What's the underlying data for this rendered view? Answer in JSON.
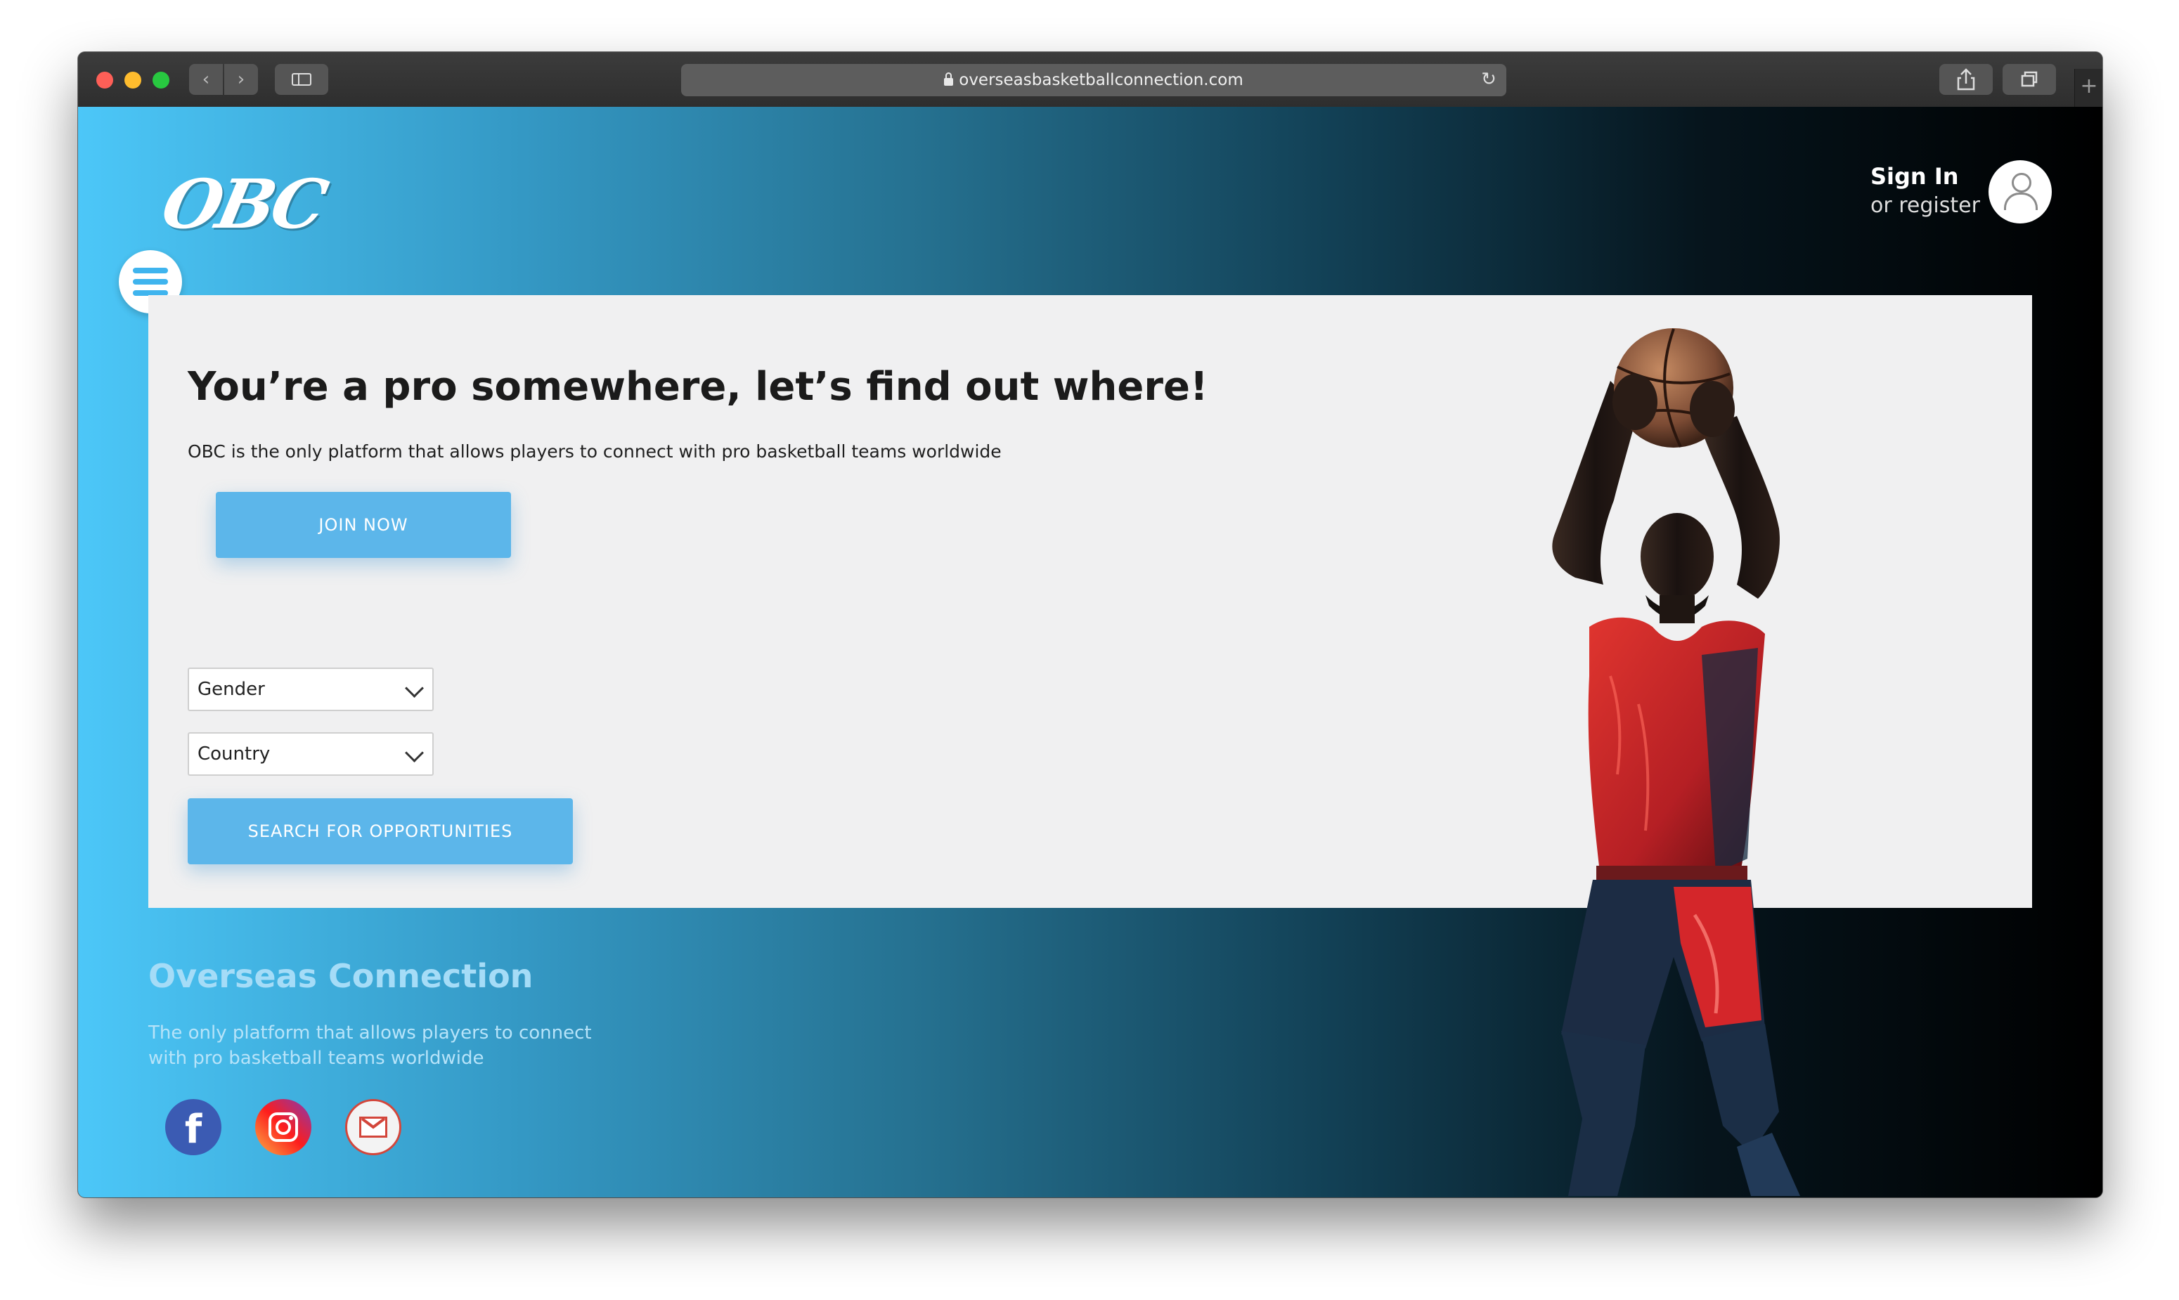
{
  "browser": {
    "url": "overseasbasketballconnection.com",
    "nav_back": "‹",
    "nav_forward": "›",
    "reload": "↻",
    "new_tab": "+"
  },
  "header": {
    "logo_text": "OBC",
    "signin_label": "Sign In",
    "register_label": "or register"
  },
  "hero": {
    "title": "You’re a pro somewhere, let’s find out where!",
    "subtitle": "OBC is the only platform that allows players to connect with pro basketball teams worldwide",
    "join_button": "JOIN NOW"
  },
  "search": {
    "gender_label": "Gender",
    "country_label": "Country",
    "search_button": "SEARCH FOR OPPORTUNITIES"
  },
  "footer": {
    "title": "Overseas Connection",
    "text": "The only platform that allows players to connect with pro basketball teams worldwide",
    "facebook_glyph": "f"
  },
  "icons": {
    "menu": "hamburger-icon",
    "user": "user-icon",
    "social": [
      "facebook-icon",
      "instagram-icon",
      "gmail-icon"
    ]
  },
  "colors": {
    "accent": "#5cb6ea",
    "gradient_start": "#4cc7f8",
    "gradient_end": "#000000",
    "card_bg": "#f0f0f1",
    "jersey": "#c0262a"
  }
}
